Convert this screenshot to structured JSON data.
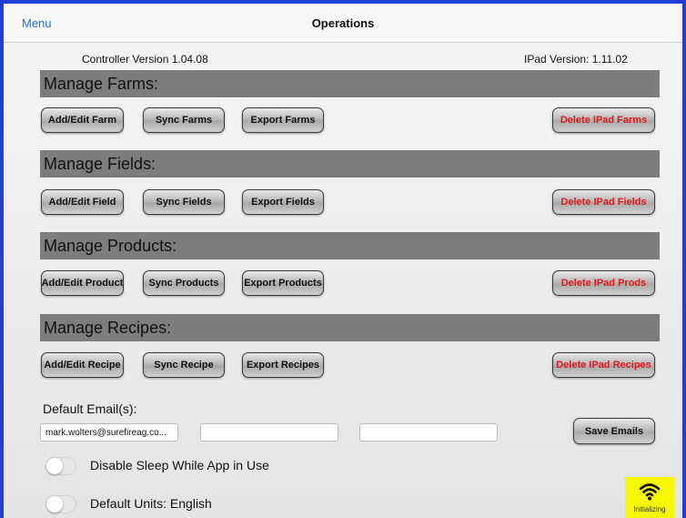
{
  "nav": {
    "menu_label": "Menu",
    "title": "Operations"
  },
  "versions": {
    "controller": "Controller Version 1.04.08",
    "ipad": "IPad Version: 1.11.02"
  },
  "sections": {
    "farms": {
      "title": "Manage Farms:",
      "add": "Add/Edit Farm",
      "sync": "Sync Farms",
      "export": "Export Farms",
      "delete": "Delete IPad Farms"
    },
    "fields": {
      "title": "Manage Fields:",
      "add": "Add/Edit Field",
      "sync": "Sync Fields",
      "export": "Export Fields",
      "delete": "Delete IPad Fields"
    },
    "products": {
      "title": "Manage Products:",
      "add": "Add/Edit Product",
      "sync": "Sync Products",
      "export": "Export Products",
      "delete": "Delete IPad Prods"
    },
    "recipes": {
      "title": "Manage Recipes:",
      "add": "Add/Edit Recipe",
      "sync": "Sync Recipe",
      "export": "Export Recipes",
      "delete": "Delete IPad Recipes"
    }
  },
  "emails": {
    "label": "Default Email(s):",
    "email1": "mark.wolters@surefireag.co...",
    "email2": "",
    "email3": "",
    "save_label": "Save Emails"
  },
  "toggles": {
    "sleep": {
      "label": "Disable Sleep While App in Use",
      "on": false
    },
    "units": {
      "label": "Default Units: English",
      "on": false
    }
  },
  "status": {
    "icon": "wifi-icon",
    "text": "Initializing",
    "background": "#f7f700"
  },
  "colors": {
    "accent": "#1c6fe8",
    "frame": "#1f3fd8",
    "danger": "#e01a1a",
    "section_bar": "#7d7d7d"
  }
}
